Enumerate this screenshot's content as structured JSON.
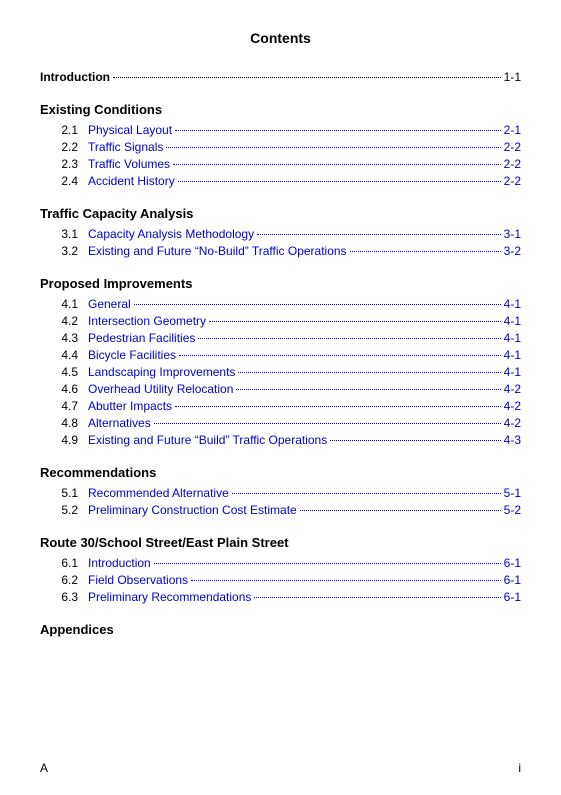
{
  "title": "Contents",
  "sections": [
    {
      "heading": null,
      "entries": [
        {
          "number": "",
          "title": "Introduction",
          "page": "1-1",
          "toplevel": true
        }
      ]
    },
    {
      "heading": "Existing Conditions",
      "entries": [
        {
          "number": "2.1",
          "title": "Physical Layout",
          "page": "2-1"
        },
        {
          "number": "2.2",
          "title": "Traffic Signals",
          "page": "2-2"
        },
        {
          "number": "2.3",
          "title": "Traffic Volumes",
          "page": "2-2"
        },
        {
          "number": "2.4",
          "title": "Accident History",
          "page": "2-2"
        }
      ]
    },
    {
      "heading": "Traffic Capacity Analysis",
      "entries": [
        {
          "number": "3.1",
          "title": "Capacity Analysis Methodology",
          "page": "3-1"
        },
        {
          "number": "3.2",
          "title": "Existing and Future “No-Build” Traffic Operations",
          "page": "3-2"
        }
      ]
    },
    {
      "heading": "Proposed Improvements",
      "entries": [
        {
          "number": "4.1",
          "title": "General",
          "page": "4-1"
        },
        {
          "number": "4.2",
          "title": "Intersection Geometry",
          "page": "4-1"
        },
        {
          "number": "4.3",
          "title": "Pedestrian Facilities",
          "page": "4-1"
        },
        {
          "number": "4.4",
          "title": "Bicycle Facilities",
          "page": "4-1"
        },
        {
          "number": "4.5",
          "title": "Landscaping Improvements",
          "page": "4-1"
        },
        {
          "number": "4.6",
          "title": "Overhead Utility Relocation",
          "page": "4-2"
        },
        {
          "number": "4.7",
          "title": "Abutter Impacts",
          "page": "4-2"
        },
        {
          "number": "4.8",
          "title": "Alternatives",
          "page": "4-2"
        },
        {
          "number": "4.9",
          "title": "Existing and Future “Build” Traffic Operations",
          "page": "4-3"
        }
      ]
    },
    {
      "heading": "Recommendations",
      "entries": [
        {
          "number": "5.1",
          "title": "Recommended Alternative",
          "page": "5-1"
        },
        {
          "number": "5.2",
          "title": "Preliminary Construction Cost Estimate",
          "page": "5-2"
        }
      ]
    },
    {
      "heading": "Route 30/School Street/East Plain Street",
      "entries": [
        {
          "number": "6.1",
          "title": "Introduction",
          "page": "6-1"
        },
        {
          "number": "6.2",
          "title": "Field Observations",
          "page": "6-1"
        },
        {
          "number": "6.3",
          "title": "Preliminary Recommendations",
          "page": "6-1"
        }
      ]
    },
    {
      "heading": "Appendices",
      "entries": []
    }
  ],
  "footer": {
    "left": "A",
    "right": "i"
  }
}
